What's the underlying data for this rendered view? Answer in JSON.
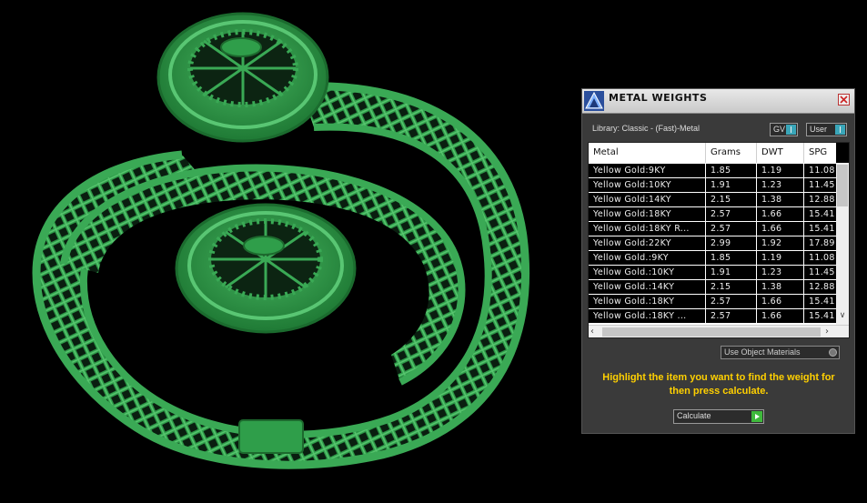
{
  "panel": {
    "title": "METAL WEIGHTS",
    "library": "Library: Classic - (Fast)-Metal",
    "toggles": [
      "GV",
      "User"
    ],
    "columns": [
      "Metal",
      "Grams",
      "DWT",
      "SPG"
    ],
    "rows": [
      [
        "Yellow Gold:9KY",
        "1.85",
        "1.19",
        "11.08"
      ],
      [
        "Yellow Gold:10KY",
        "1.91",
        "1.23",
        "11.45"
      ],
      [
        "Yellow Gold:14KY",
        "2.15",
        "1.38",
        "12.88"
      ],
      [
        "Yellow Gold:18KY",
        "2.57",
        "1.66",
        "15.41"
      ],
      [
        "Yellow Gold:18KY R...",
        "2.57",
        "1.66",
        "15.41"
      ],
      [
        "Yellow Gold:22KY",
        "2.99",
        "1.92",
        "17.89"
      ],
      [
        "Yellow Gold.:9KY",
        "1.85",
        "1.19",
        "11.08"
      ],
      [
        "Yellow Gold.:10KY",
        "1.91",
        "1.23",
        "11.45"
      ],
      [
        "Yellow Gold.:14KY",
        "2.15",
        "1.38",
        "12.88"
      ],
      [
        "Yellow Gold.:18KY",
        "2.57",
        "1.66",
        "15.41"
      ],
      [
        "Yellow Gold.:18KY ...",
        "2.57",
        "1.66",
        "15.41"
      ]
    ],
    "use_object_materials": "Use Object Materials",
    "hint": "Highlight the item you want to find the weight for then press calculate.",
    "calculate": "Calculate"
  },
  "colors": {
    "model_green": "#2f9e4a",
    "hint_yellow": "#ffd000",
    "toggle_teal": "#3aa6b9",
    "go_green": "#3fb93c"
  }
}
